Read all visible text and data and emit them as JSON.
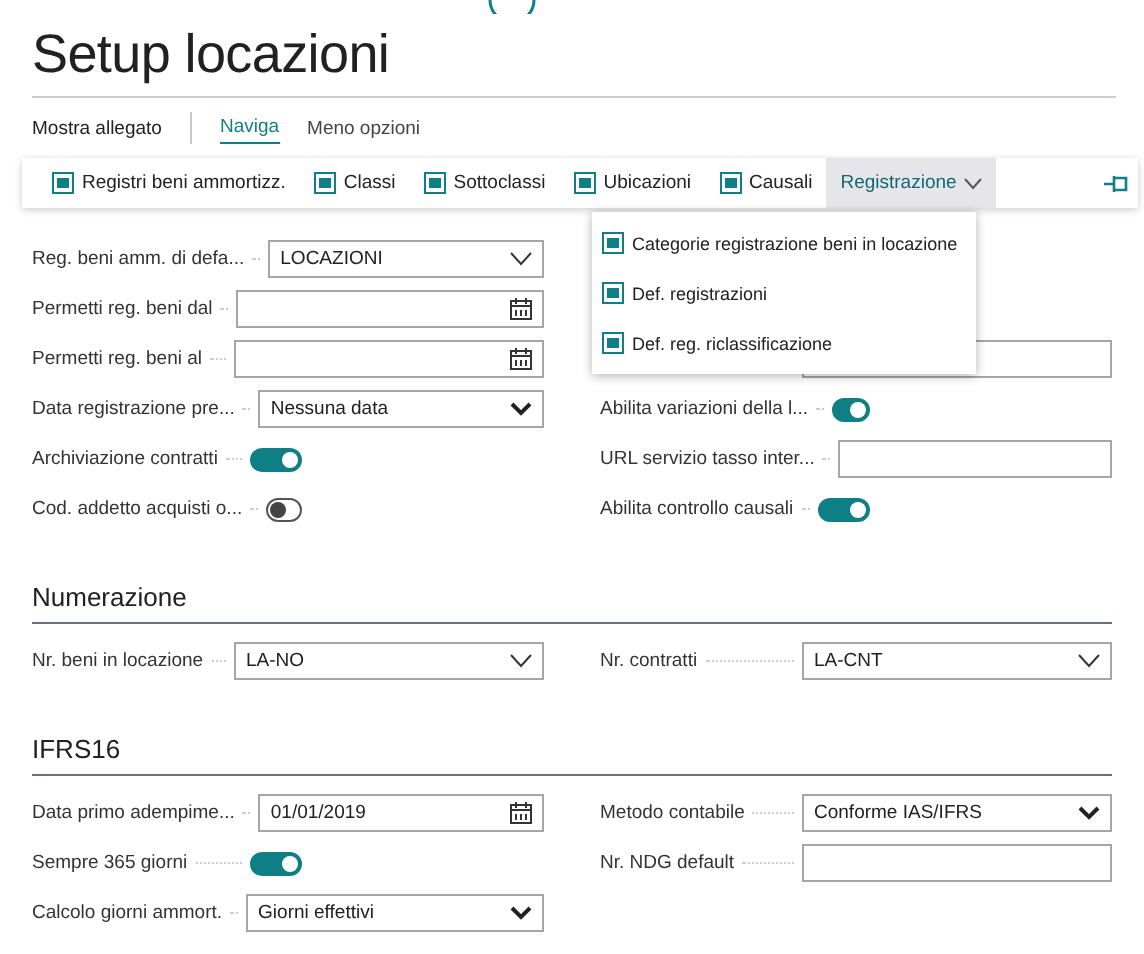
{
  "page": {
    "title": "Setup locazioni"
  },
  "actions": [
    {
      "label": "Mostra allegato",
      "kind": "plain"
    },
    {
      "label": "Naviga",
      "kind": "tab",
      "selected": true
    },
    {
      "label": "Meno opzioni",
      "kind": "tab",
      "selected": false
    }
  ],
  "toolbar": {
    "items": [
      {
        "label": "Registri beni ammortizz.",
        "selected": false,
        "dropdown": false
      },
      {
        "label": "Classi",
        "selected": false,
        "dropdown": false
      },
      {
        "label": "Sottoclassi",
        "selected": false,
        "dropdown": false
      },
      {
        "label": "Ubicazioni",
        "selected": false,
        "dropdown": false
      },
      {
        "label": "Causali",
        "selected": false,
        "dropdown": false
      },
      {
        "label": "Registrazione",
        "selected": true,
        "dropdown": true
      }
    ]
  },
  "menu": {
    "items": [
      "Categorie registrazione beni in locazione",
      "Def. registrazioni",
      "Def. reg. riclassificazione"
    ]
  },
  "general": {
    "left": [
      {
        "label": "Reg. beni amm. di defa...",
        "kind": "lookup",
        "value": "LOCAZIONI"
      },
      {
        "label": "Permetti reg. beni dal",
        "kind": "date"
      },
      {
        "label": "Permetti reg. beni al",
        "kind": "date"
      },
      {
        "label": "Data registrazione pre...",
        "kind": "option",
        "value": "Nessuna data"
      },
      {
        "label": "Archiviazione contratti",
        "kind": "toggle",
        "on": true
      },
      {
        "label": "Cod. addetto acquisti o...",
        "kind": "toggle",
        "on": false
      }
    ],
    "right": [
      {
        "kind": "covered"
      },
      {
        "label": "Abilita variazioni della l...",
        "kind": "toggle",
        "on": true
      },
      {
        "label": "URL servizio tasso inter...",
        "kind": "text"
      },
      {
        "label": "Abilita controllo causali",
        "kind": "toggle",
        "on": true
      }
    ]
  },
  "sections": [
    {
      "title": "Numerazione",
      "left": [
        {
          "label": "Nr. beni in locazione",
          "kind": "lookup",
          "value": "LA-NO"
        }
      ],
      "right": [
        {
          "label": "Nr. contratti",
          "kind": "lookup",
          "value": "LA-CNT"
        }
      ]
    },
    {
      "title": "IFRS16",
      "left": [
        {
          "label": "Data primo adempime...",
          "kind": "date",
          "value": "01/01/2019"
        },
        {
          "label": "Sempre 365 giorni",
          "kind": "toggle",
          "on": true
        },
        {
          "label": "Calcolo giorni ammort.",
          "kind": "option",
          "value": "Giorni effettivi"
        }
      ],
      "right": [
        {
          "label": "Metodo contabile",
          "kind": "option",
          "value": "Conforme IAS/IFRS"
        },
        {
          "label": "Nr. NDG default",
          "kind": "text"
        }
      ]
    }
  ]
}
